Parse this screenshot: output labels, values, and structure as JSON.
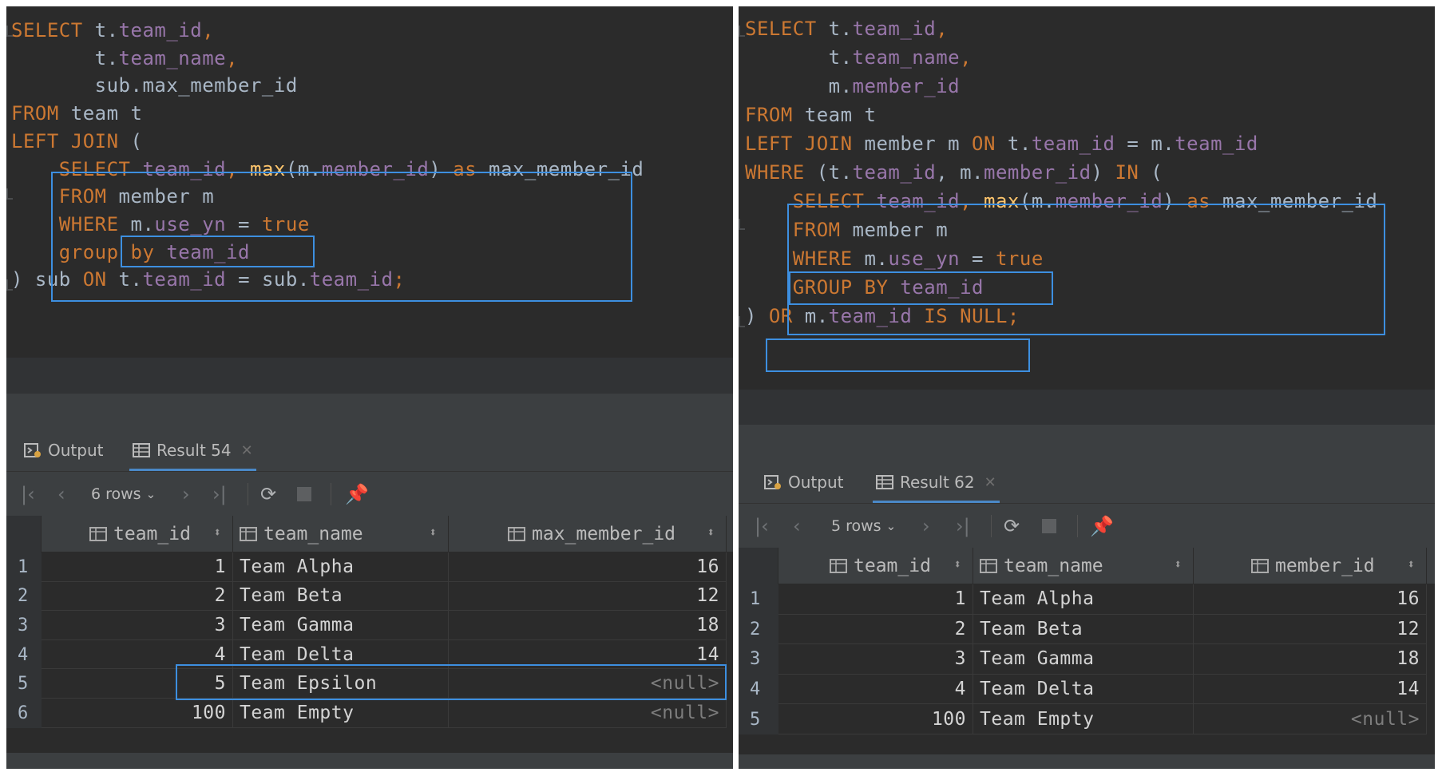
{
  "left": {
    "code": [
      [
        {
          "t": "SELECT",
          "c": "kw"
        },
        {
          "t": " t.",
          "c": "plain"
        },
        {
          "t": "team_id",
          "c": "col"
        },
        {
          "t": ",",
          "c": "kw"
        }
      ],
      [
        {
          "t": "       t.",
          "c": "plain"
        },
        {
          "t": "team_name",
          "c": "col"
        },
        {
          "t": ",",
          "c": "kw"
        }
      ],
      [
        {
          "t": "       sub.max_member_id",
          "c": "plain"
        }
      ],
      [
        {
          "t": "FROM",
          "c": "kw"
        },
        {
          "t": " team t",
          "c": "plain"
        }
      ],
      [
        {
          "t": "LEFT JOIN",
          "c": "kw"
        },
        {
          "t": " (",
          "c": "plain"
        }
      ],
      [
        {
          "t": "    ",
          "c": "plain"
        },
        {
          "t": "SELECT",
          "c": "kw"
        },
        {
          "t": " ",
          "c": "plain"
        },
        {
          "t": "team_id",
          "c": "col"
        },
        {
          "t": ", ",
          "c": "kw"
        },
        {
          "t": "max",
          "c": "fn"
        },
        {
          "t": "(m.",
          "c": "plain"
        },
        {
          "t": "member_id",
          "c": "col"
        },
        {
          "t": ") ",
          "c": "plain"
        },
        {
          "t": "as",
          "c": "kw"
        },
        {
          "t": " max_member_id",
          "c": "plain"
        }
      ],
      [
        {
          "t": "    ",
          "c": "plain"
        },
        {
          "t": "FROM",
          "c": "kw"
        },
        {
          "t": " member m",
          "c": "plain"
        }
      ],
      [
        {
          "t": "    ",
          "c": "plain"
        },
        {
          "t": "WHERE",
          "c": "kw"
        },
        {
          "t": " m.",
          "c": "plain"
        },
        {
          "t": "use_yn",
          "c": "col"
        },
        {
          "t": " = ",
          "c": "plain"
        },
        {
          "t": "true",
          "c": "kw"
        }
      ],
      [
        {
          "t": "    ",
          "c": "plain"
        },
        {
          "t": "group by",
          "c": "kw"
        },
        {
          "t": " ",
          "c": "plain"
        },
        {
          "t": "team_id",
          "c": "col"
        }
      ],
      [
        {
          "t": ") sub ",
          "c": "plain"
        },
        {
          "t": "ON",
          "c": "kw"
        },
        {
          "t": " t.",
          "c": "plain"
        },
        {
          "t": "team_id",
          "c": "col"
        },
        {
          "t": " = sub.",
          "c": "plain"
        },
        {
          "t": "team_id",
          "c": "col"
        },
        {
          "t": ";",
          "c": "kw"
        }
      ]
    ],
    "tabs": {
      "output": "Output",
      "result": "Result 54"
    },
    "rows_label": "6 rows",
    "columns": [
      "team_id",
      "team_name",
      "max_member_id"
    ],
    "rows": [
      {
        "n": "1",
        "id": "1",
        "name": "Team Alpha",
        "v": "16"
      },
      {
        "n": "2",
        "id": "2",
        "name": "Team Beta",
        "v": "12"
      },
      {
        "n": "3",
        "id": "3",
        "name": "Team Gamma",
        "v": "18"
      },
      {
        "n": "4",
        "id": "4",
        "name": "Team Delta",
        "v": "14"
      },
      {
        "n": "5",
        "id": "5",
        "name": "Team Epsilon",
        "v": "<null>"
      },
      {
        "n": "6",
        "id": "100",
        "name": "Team Empty",
        "v": "<null>"
      }
    ]
  },
  "right": {
    "code": [
      [
        {
          "t": "SELECT",
          "c": "kw"
        },
        {
          "t": " t.",
          "c": "plain"
        },
        {
          "t": "team_id",
          "c": "col"
        },
        {
          "t": ",",
          "c": "kw"
        }
      ],
      [
        {
          "t": "       t.",
          "c": "plain"
        },
        {
          "t": "team_name",
          "c": "col"
        },
        {
          "t": ",",
          "c": "kw"
        }
      ],
      [
        {
          "t": "       m.",
          "c": "plain"
        },
        {
          "t": "member_id",
          "c": "col"
        }
      ],
      [
        {
          "t": "FROM",
          "c": "kw"
        },
        {
          "t": " team t",
          "c": "plain"
        }
      ],
      [
        {
          "t": "LEFT JOIN",
          "c": "kw"
        },
        {
          "t": " member m ",
          "c": "plain"
        },
        {
          "t": "ON",
          "c": "kw"
        },
        {
          "t": " t.",
          "c": "plain"
        },
        {
          "t": "team_id",
          "c": "col"
        },
        {
          "t": " = m.",
          "c": "plain"
        },
        {
          "t": "team_id",
          "c": "col"
        }
      ],
      [
        {
          "t": "WHERE",
          "c": "kw"
        },
        {
          "t": " (t.",
          "c": "plain"
        },
        {
          "t": "team_id",
          "c": "col"
        },
        {
          "t": ", m.",
          "c": "plain"
        },
        {
          "t": "member_id",
          "c": "col"
        },
        {
          "t": ") ",
          "c": "plain"
        },
        {
          "t": "IN",
          "c": "kw"
        },
        {
          "t": " (",
          "c": "plain"
        }
      ],
      [
        {
          "t": "    ",
          "c": "plain"
        },
        {
          "t": "SELECT",
          "c": "kw"
        },
        {
          "t": " ",
          "c": "plain"
        },
        {
          "t": "team_id",
          "c": "col"
        },
        {
          "t": ", ",
          "c": "kw"
        },
        {
          "t": "max",
          "c": "fn"
        },
        {
          "t": "(m.",
          "c": "plain"
        },
        {
          "t": "member_id",
          "c": "col"
        },
        {
          "t": ") ",
          "c": "plain"
        },
        {
          "t": "as",
          "c": "kw"
        },
        {
          "t": " max_member_id",
          "c": "plain"
        }
      ],
      [
        {
          "t": "    ",
          "c": "plain"
        },
        {
          "t": "FROM",
          "c": "kw"
        },
        {
          "t": " member m",
          "c": "plain"
        }
      ],
      [
        {
          "t": "    ",
          "c": "plain"
        },
        {
          "t": "WHERE",
          "c": "kw"
        },
        {
          "t": " m.",
          "c": "plain"
        },
        {
          "t": "use_yn",
          "c": "col"
        },
        {
          "t": " = ",
          "c": "plain"
        },
        {
          "t": "true",
          "c": "kw"
        }
      ],
      [
        {
          "t": "    ",
          "c": "plain"
        },
        {
          "t": "GROUP BY",
          "c": "kw"
        },
        {
          "t": " ",
          "c": "plain"
        },
        {
          "t": "team_id",
          "c": "col"
        }
      ],
      [
        {
          "t": ") ",
          "c": "plain"
        },
        {
          "t": "OR",
          "c": "kw"
        },
        {
          "t": " m.",
          "c": "plain"
        },
        {
          "t": "team_id",
          "c": "col"
        },
        {
          "t": " ",
          "c": "plain"
        },
        {
          "t": "IS NULL;",
          "c": "kw"
        }
      ]
    ],
    "tabs": {
      "output": "Output",
      "result": "Result 62"
    },
    "rows_label": "5 rows",
    "columns": [
      "team_id",
      "team_name",
      "member_id"
    ],
    "rows": [
      {
        "n": "1",
        "id": "1",
        "name": "Team Alpha",
        "v": "16"
      },
      {
        "n": "2",
        "id": "2",
        "name": "Team Beta",
        "v": "12"
      },
      {
        "n": "3",
        "id": "3",
        "name": "Team Gamma",
        "v": "18"
      },
      {
        "n": "4",
        "id": "4",
        "name": "Team Delta",
        "v": "14"
      },
      {
        "n": "5",
        "id": "100",
        "name": "Team Empty",
        "v": "<null>"
      }
    ]
  },
  "colors": {
    "keyword": "#cc7832",
    "identifier": "#9876aa",
    "function": "#ffc66d",
    "text": "#a9b7c6",
    "highlight": "#3d8fe0",
    "editor_bg": "#2b2b2b",
    "panel_bg": "#3c3f41"
  },
  "icons": [
    "output-icon",
    "table-icon",
    "first-page-icon",
    "prev-page-icon",
    "next-page-icon",
    "last-page-icon",
    "refresh-icon",
    "stop-icon",
    "pin-icon",
    "column-icon",
    "sort-icon",
    "close-icon",
    "chevron-down-icon"
  ]
}
